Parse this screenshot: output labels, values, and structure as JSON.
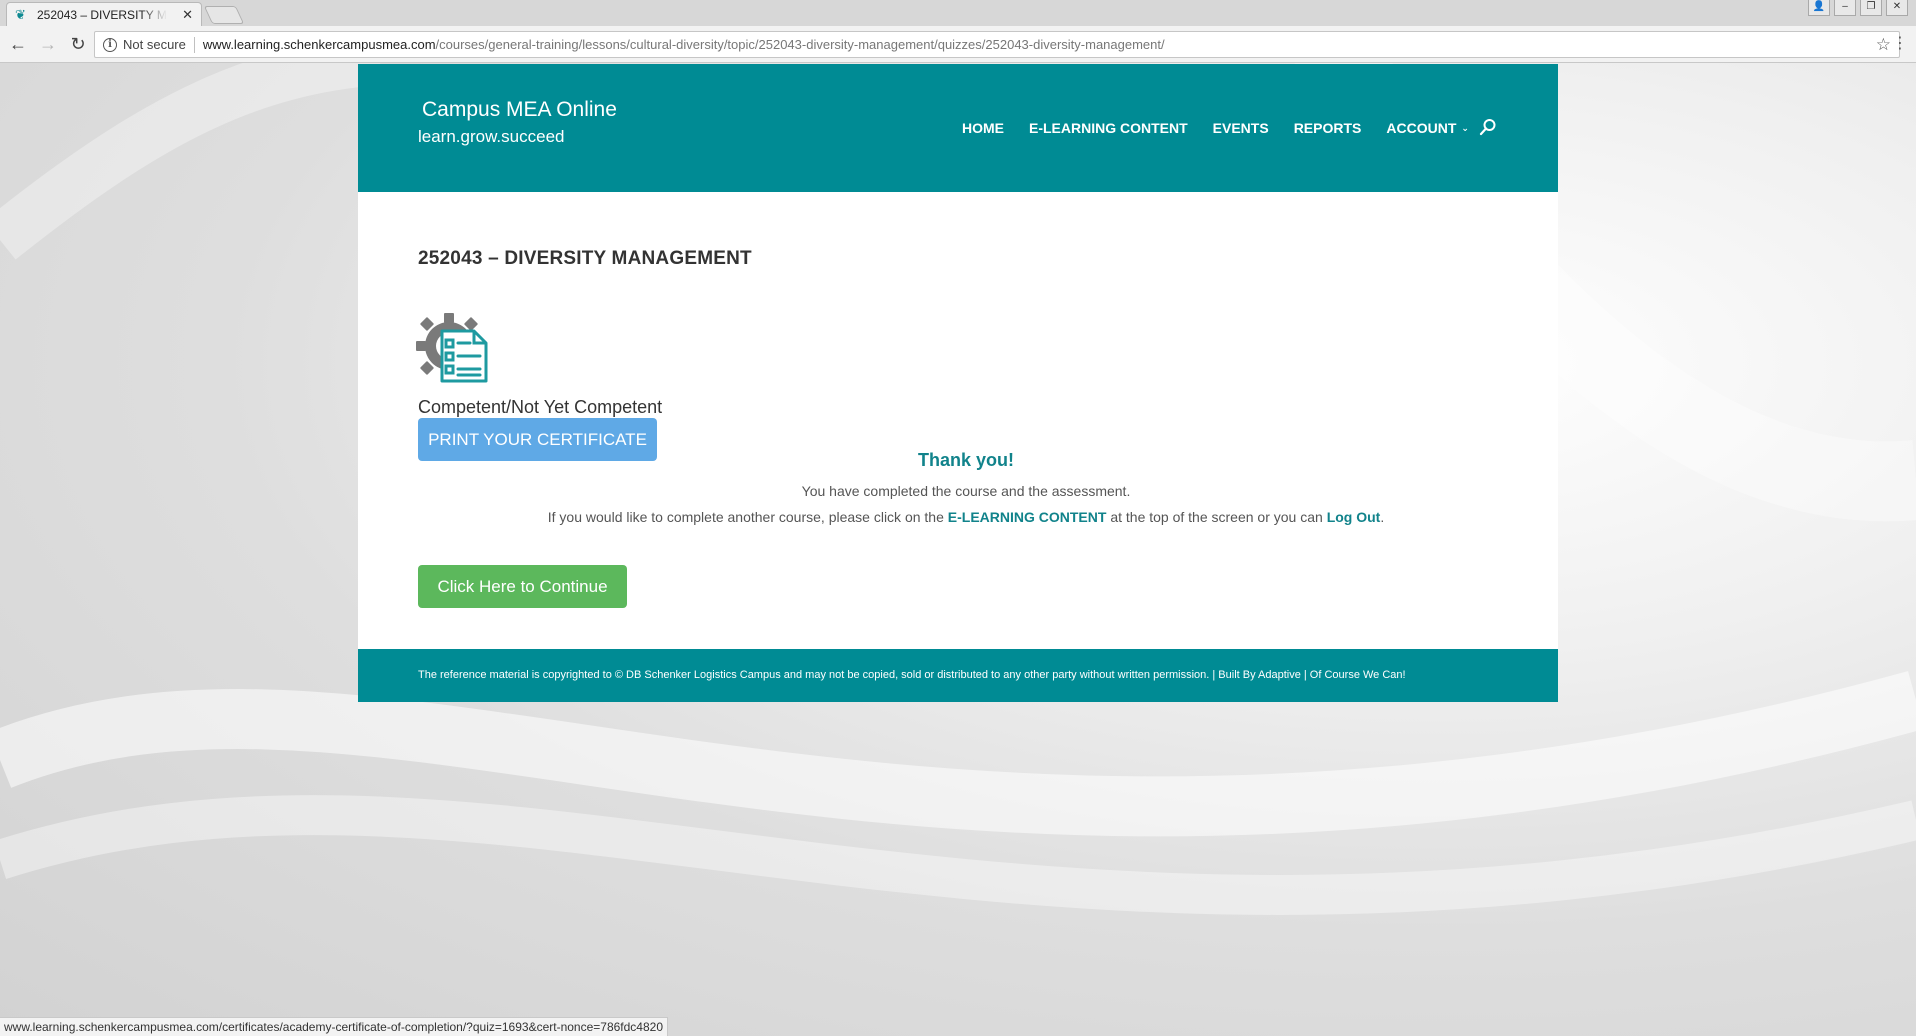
{
  "browser": {
    "tab_title": "252043 – DIVERSITY MANAGEMENT",
    "tab_close": "✕",
    "security_label": "Not secure",
    "url_host": "www.learning.schenkercampusmea.com",
    "url_path": "/courses/general-training/lessons/cultural-diversity/topic/252043-diversity-management/quizzes/252043-diversity-management/",
    "status_url": "www.learning.schenkercampusmea.com/certificates/academy-certificate-of-completion/?quiz=1693&cert-nonce=786fdc4820"
  },
  "site": {
    "title": "Campus MEA Online",
    "tagline": "learn.grow.succeed",
    "nav": [
      {
        "label": "HOME"
      },
      {
        "label": "E-LEARNING CONTENT"
      },
      {
        "label": "EVENTS"
      },
      {
        "label": "REPORTS"
      },
      {
        "label": "ACCOUNT"
      }
    ]
  },
  "content": {
    "page_title": "252043 – DIVERSITY MANAGEMENT",
    "result_label": "Competent/Not Yet Competent",
    "print_button": "PRINT YOUR CERTIFICATE",
    "thanks": "Thank you!",
    "completed_text": "You have completed the course and the assessment.",
    "another_prefix": "If you would like to complete another course, please click on the ",
    "another_link": "E-LEARNING CONTENT",
    "another_middle": " at the top of the screen or you can ",
    "logout_link": "Log Out",
    "another_suffix": ".",
    "continue_button": "Click Here to Continue"
  },
  "footer": {
    "text": "The reference material is copyrighted to © DB Schenker Logistics Campus and may not be copied, sold or distributed to any other party without written permission. | Built By Adaptive | Of Course We Can!"
  },
  "colors": {
    "brand_teal": "#008b94",
    "link_teal": "#11838b",
    "print_blue": "#5fa9e6",
    "continue_green": "#5cb85c"
  }
}
